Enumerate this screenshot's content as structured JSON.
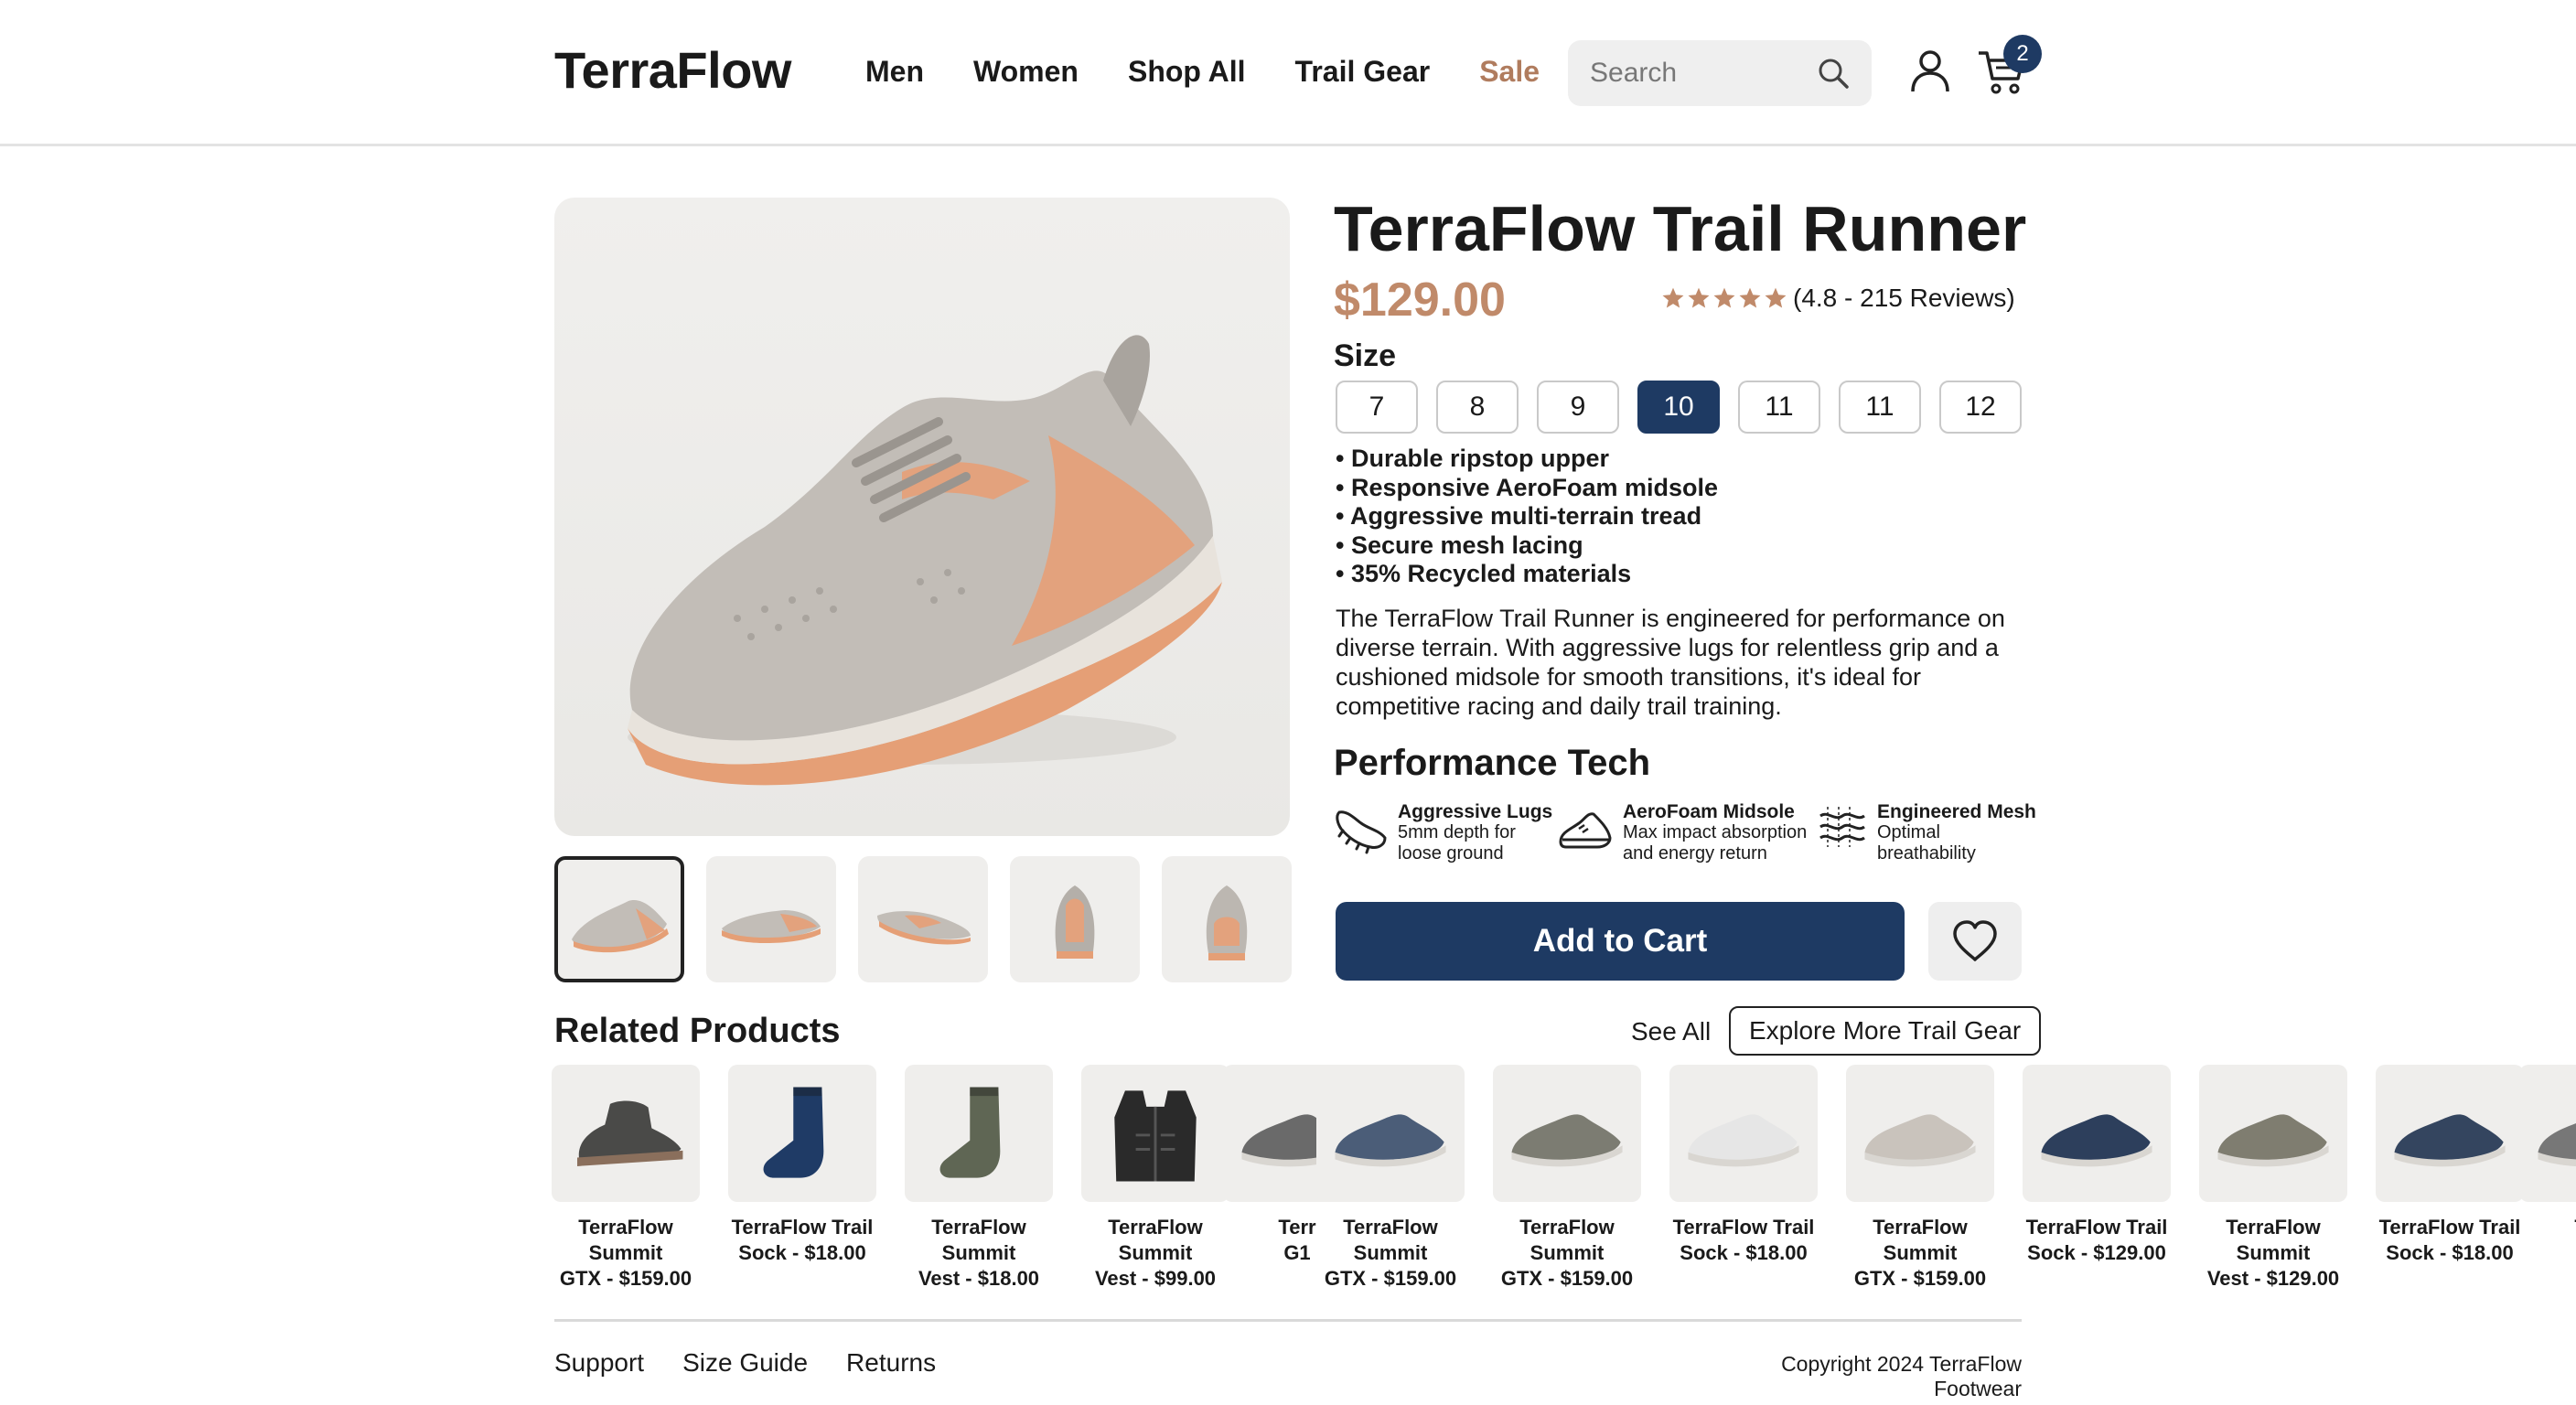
{
  "header": {
    "logo": "TerraFlow",
    "nav": [
      "Men",
      "Women",
      "Shop All",
      "Trail Gear",
      "Sale"
    ],
    "search_placeholder": "Search",
    "cart_count": "2"
  },
  "product": {
    "title": "TerraFlow Trail Runner",
    "price": "$129.00",
    "rating_text": "(4.8 - 215 Reviews)",
    "rating": 4.8,
    "size_label": "Size",
    "sizes": [
      "7",
      "8",
      "9",
      "10",
      "11",
      "11",
      "12"
    ],
    "selected_size": "10",
    "features": [
      "• Durable ripstop upper",
      "• Responsive AeroFoam midsole",
      "• Aggressive multi-terrain tread",
      "• Secure mesh lacing",
      "• 35% Recycled materials"
    ],
    "description": "The TerraFlow Trail Runner is engineered for performance on diverse terrain. With aggressive lugs for relentless grip and a cushioned midsole for smooth transitions, it's ideal for competitive racing and daily trail training.",
    "performance_title": "Performance Tech",
    "tech": [
      {
        "icon": "shoe-tread-icon",
        "title": "Aggressive Lugs",
        "l1": "5mm depth for",
        "l2": "loose ground"
      },
      {
        "icon": "shoe-midsole-icon",
        "title": "AeroFoam Midsole",
        "l1": "Max impact absorption",
        "l2": "and energy return"
      },
      {
        "icon": "mesh-icon",
        "title": "Engineered Mesh",
        "l1": "Optimal",
        "l2": "breathability"
      }
    ],
    "add_to_cart": "Add to Cart"
  },
  "related": {
    "title": "Related Products",
    "see_all": "See All",
    "explore": "Explore More Trail Gear",
    "items": [
      {
        "l1": "TerraFlow Summit",
        "l2": "GTX - $159.00",
        "kind": "boot",
        "color": "#4a4a48"
      },
      {
        "l1": "TerraFlow Trail",
        "l2": "Sock - $18.00",
        "kind": "sock",
        "color": "#1f3b66"
      },
      {
        "l1": "TerraFlow Summit",
        "l2": "Vest - $18.00",
        "kind": "sock",
        "color": "#5f6654"
      },
      {
        "l1": "TerraFlow Summit",
        "l2": "Vest - $99.00",
        "kind": "vest",
        "color": "#2a2a2a"
      },
      {
        "l1": "Terr",
        "l2": "G1",
        "kind": "shoe",
        "color": "#6a6a6a"
      },
      {
        "l1": "TerraFlow Summit",
        "l2": "GTX - $159.00",
        "kind": "shoe",
        "color": "#4b5d78"
      },
      {
        "l1": "TerraFlow Summit",
        "l2": "GTX - $159.00",
        "kind": "shoe",
        "color": "#7c7c72"
      },
      {
        "l1": "TerraFlow Trail",
        "l2": "Sock - $18.00",
        "kind": "shoe",
        "color": "#e6e6e6"
      },
      {
        "l1": "TerraFlow Summit",
        "l2": "GTX - $159.00",
        "kind": "shoe",
        "color": "#c9c3bc"
      },
      {
        "l1": "TerraFlow Trail",
        "l2": "Sock - $129.00",
        "kind": "shoe",
        "color": "#2d3f5c"
      },
      {
        "l1": "TerraFlow Summit",
        "l2": "Vest - $129.00",
        "kind": "shoe",
        "color": "#7f7d70"
      },
      {
        "l1": "TerraFlow Trail",
        "l2": "Sock - $18.00",
        "kind": "shoe",
        "color": "#34455f"
      },
      {
        "l1": "Terr",
        "l2": "G",
        "kind": "shoe",
        "color": "#777777"
      }
    ]
  },
  "footer": {
    "links": [
      "Support",
      "Size Guide",
      "Returns"
    ],
    "copyright": "Copyright 2024 TerraFlow Footwear"
  },
  "colors": {
    "primary": "#1e3a63",
    "accent": "#c08a6a",
    "sale": "#b07c5e",
    "star": "#c08a6a"
  }
}
